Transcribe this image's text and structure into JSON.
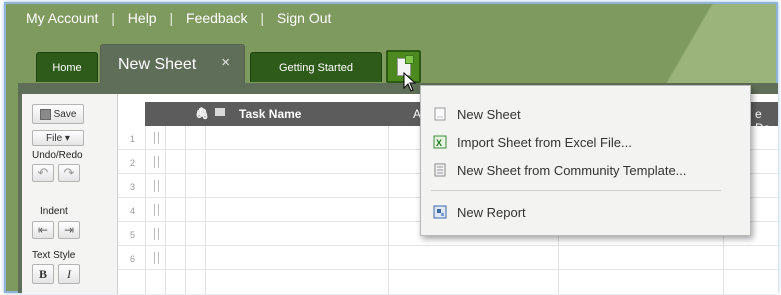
{
  "top_links": [
    "My Account",
    "Help",
    "Feedback",
    "Sign Out"
  ],
  "top_link_separator": "|",
  "tabs": {
    "home": "Home",
    "active": "New Sheet",
    "active_close": "×",
    "getting_started": "Getting Started"
  },
  "toolbar": {
    "save": "Save",
    "file": "File ▾",
    "undo_redo": "Undo/Redo",
    "undo_glyph": "↶",
    "redo_glyph": "↷",
    "indent": "Indent",
    "outdent_glyph": "⇤",
    "indent_glyph": "⇥",
    "text_style": "Text Style",
    "bold": "B",
    "italic": "I"
  },
  "grid": {
    "headers": {
      "task_name": "Task Name",
      "assigned_partial": "Ass",
      "date_partial": "e Da"
    },
    "row_numbers": [
      "1",
      "2",
      "3",
      "4",
      "5",
      "6"
    ]
  },
  "menu": {
    "items": [
      {
        "label": "New Sheet",
        "icon": "new-sheet-icon"
      },
      {
        "label": "Import Sheet from Excel File...",
        "icon": "excel-import-icon"
      },
      {
        "label": "New Sheet from Community Template...",
        "icon": "template-icon"
      },
      {
        "label": "New Report",
        "icon": "report-icon"
      }
    ]
  },
  "colors": {
    "header_bg": "#7f9a5f",
    "active_tab": "#5f6e58",
    "dark_tab": "#2e5a1a",
    "new_button": "#4c8a20",
    "grid_header": "#5c5c5c",
    "menu_bg": "#f3f3f1"
  }
}
